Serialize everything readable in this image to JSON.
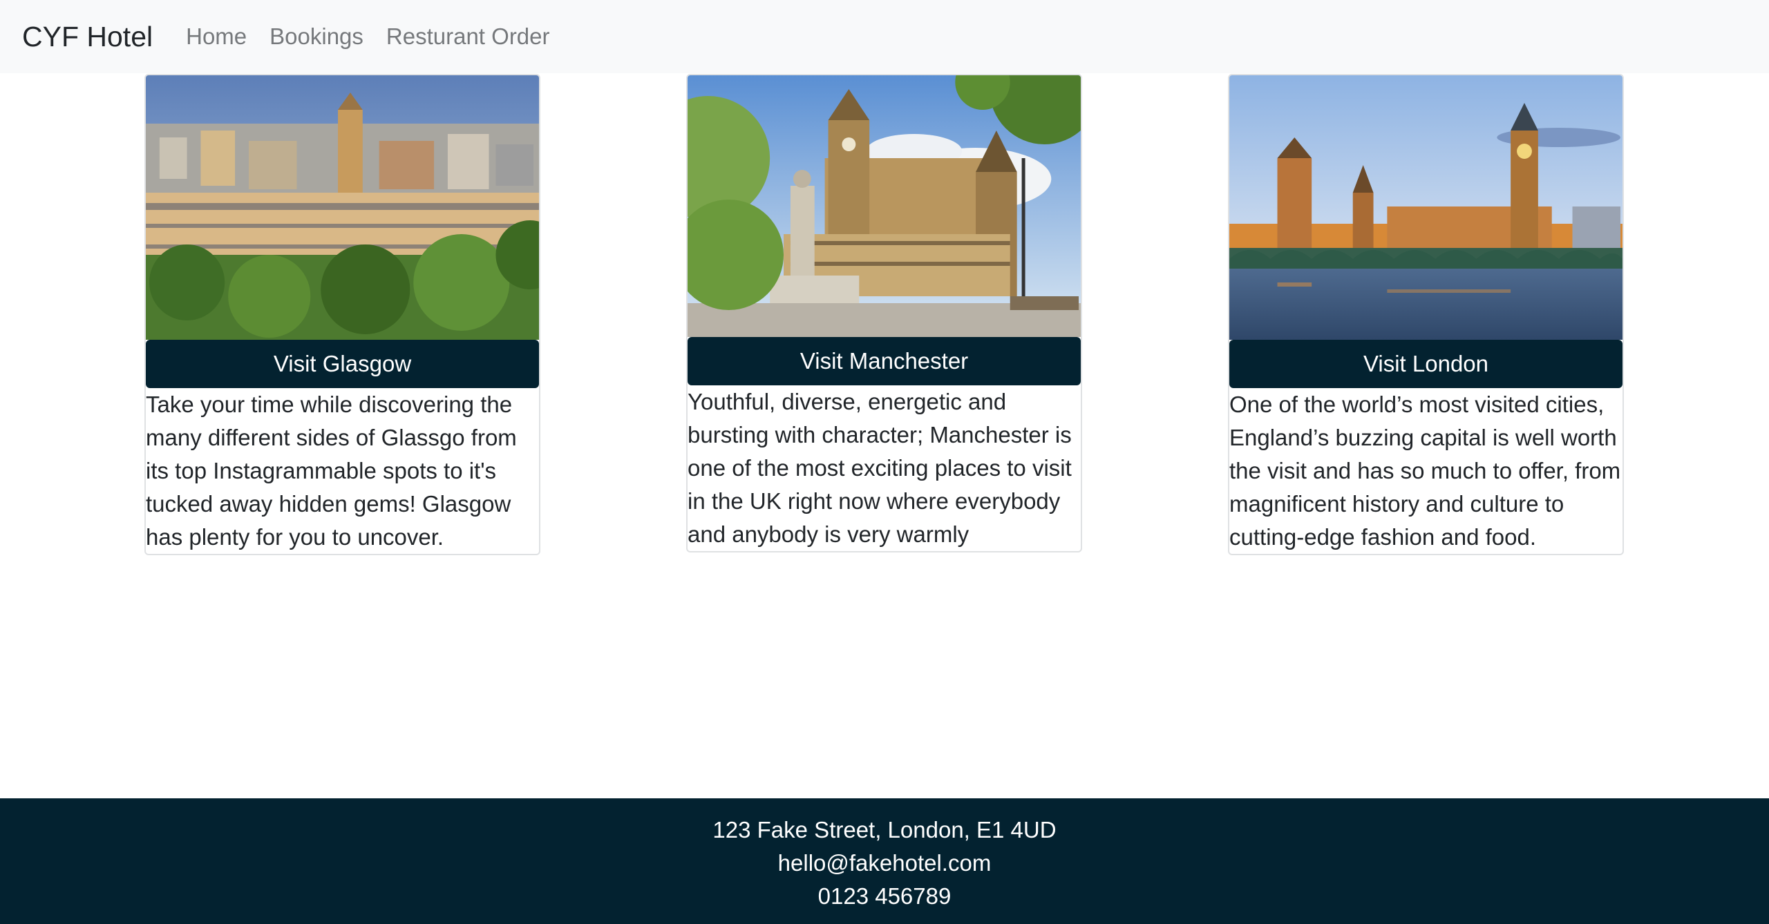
{
  "navbar": {
    "brand": "CYF Hotel",
    "links": [
      "Home",
      "Bookings",
      "Resturant Order"
    ]
  },
  "cards": [
    {
      "image_alt": "Glasgow skyline",
      "button_label": "Visit Glasgow",
      "text": "Take your time while discovering the many different sides of Glassgo from its top Instagrammable spots to it's tucked away hidden gems! Glasgow has plenty for you to uncover."
    },
    {
      "image_alt": "Manchester Town Hall",
      "button_label": "Visit Manchester",
      "text": "Youthful, diverse, energetic and bursting with character; Manchester is one of the most exciting places to visit in the UK right now where everybody and anybody is very warmly welcomed."
    },
    {
      "image_alt": "Houses of Parliament, London",
      "button_label": "Visit London",
      "text": "One of the world’s most visited cities, England’s buzzing capital is well worth the visit and has so much to offer, from magnificent history and culture to cutting-edge fashion and food."
    }
  ],
  "footer": {
    "address": "123 Fake Street, London, E1 4UD",
    "email": "hello@fakehotel.com",
    "phone": "0123 456789"
  },
  "colors": {
    "navbar_bg": "#f8f9fa",
    "accent_dark": "#032230",
    "nav_link": "#76797c"
  }
}
